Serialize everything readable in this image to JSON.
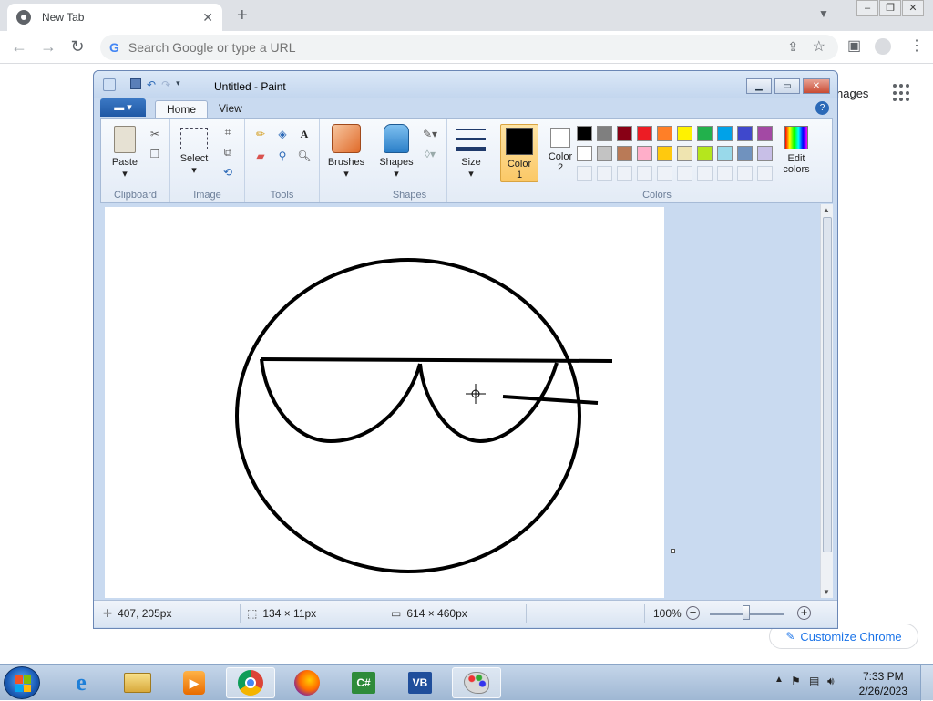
{
  "browser": {
    "tab_title": "New Tab",
    "tab_close": "✕",
    "new_tab": "+",
    "omnibox_placeholder": "Search Google or type a URL",
    "google_g": "G"
  },
  "ntp": {
    "images_link": "nages",
    "customize_label": "Customize Chrome"
  },
  "paint": {
    "title": "Untitled - Paint",
    "tabs": [
      "Home",
      "View"
    ],
    "help": "?",
    "groups": {
      "clipboard": "Clipboard",
      "image": "Image",
      "tools": "Tools",
      "shapes_group": "Shapes",
      "colors": "Colors"
    },
    "buttons": {
      "paste": "Paste",
      "select": "Select",
      "brushes": "Brushes",
      "shapes": "Shapes",
      "size": "Size",
      "color1": "Color 1",
      "color2": "Color 2",
      "edit_colors": "Edit colors"
    },
    "palette_row1": [
      "#000000",
      "#7f7f7f",
      "#880015",
      "#ed1c24",
      "#ff7f27",
      "#fff200",
      "#22b14c",
      "#00a2e8",
      "#3f48cc",
      "#a349a4"
    ],
    "palette_row2": [
      "#ffffff",
      "#c3c3c3",
      "#b97a57",
      "#ffaec9",
      "#ffc90e",
      "#efe4b0",
      "#b5e61d",
      "#99d9ea",
      "#7092be",
      "#c8bfe7"
    ],
    "color1_value": "#000000",
    "color2_value": "#ffffff",
    "status": {
      "cursor_pos": "407, 205px",
      "selection_size": "134 × 11px",
      "canvas_size": "614 × 460px",
      "zoom": "100%"
    }
  },
  "taskbar": {
    "time": "7:33 PM",
    "date": "2/26/2023",
    "apps": [
      "internet-explorer",
      "file-explorer",
      "media-player",
      "chrome",
      "firefox",
      "csharp-ide",
      "vb-ide",
      "paint"
    ]
  }
}
